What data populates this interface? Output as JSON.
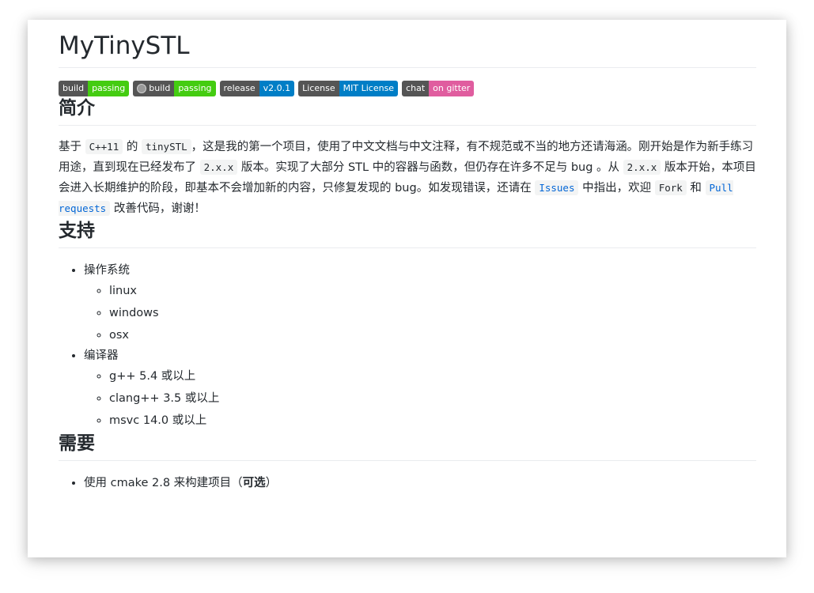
{
  "title": "MyTinySTL",
  "badges": [
    {
      "left": "build",
      "right": "passing",
      "color": "#4c1"
    },
    {
      "left": "build",
      "right": "passing",
      "color": "#4c1",
      "icon": "appveyor-icon"
    },
    {
      "left": "release",
      "right": "v2.0.1",
      "color": "#007ec6"
    },
    {
      "left": "License",
      "right": "MIT License",
      "color": "#007ec6"
    },
    {
      "left": "chat",
      "right": "on gitter",
      "color": "#e05d9f"
    }
  ],
  "intro": {
    "heading": "简介",
    "seg1": "基于 ",
    "code1": "C++11",
    "seg2": " 的 ",
    "code2": "tinySTL",
    "seg3": "，这是我的第一个项目，使用了中文文档与中文注释，有不规范或不当的地方还请海涵。刚开始是作为新手练习用途，直到现在已经发布了 ",
    "code3": "2.x.x",
    "seg4": " 版本。实现了大部分 STL 中的容器与函数，但仍存在许多不足与 bug 。从 ",
    "code4": "2.x.x",
    "seg5": " 版本开始，本项目会进入长期维护的阶段，即基本不会增加新的内容，只修复发现的 bug。如发现错误，还请在 ",
    "link_issues": "Issues",
    "seg6": " 中指出，欢迎 ",
    "code_fork": "Fork",
    "seg7": " 和 ",
    "link_pr": "Pull requests",
    "seg8": " 改善代码，谢谢！"
  },
  "support": {
    "heading": "支持",
    "os_label": "操作系统",
    "os_items": [
      "linux",
      "windows",
      "osx"
    ],
    "compiler_label": "编译器",
    "compiler_items": [
      "g++ 5.4 或以上",
      "clang++ 3.5 或以上",
      "msvc 14.0 或以上"
    ]
  },
  "require": {
    "heading": "需要",
    "item_prefix": "使用 cmake 2.8 来构建项目（",
    "item_bold": "可选",
    "item_suffix": "）"
  }
}
